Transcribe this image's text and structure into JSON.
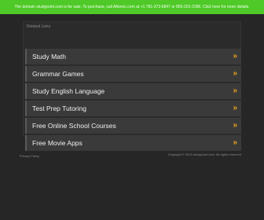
{
  "banner": {
    "text": "The domain studypoint.com is for sale. To purchase, call Afternic.com at +1 781-373-6847 or 855-201-2286. Click here for more details."
  },
  "panel": {
    "title": "Related Links",
    "links": [
      {
        "label": "Study Math",
        "arrow": "»"
      },
      {
        "label": "Grammar Games",
        "arrow": "»"
      },
      {
        "label": "Study English Language",
        "arrow": "»"
      },
      {
        "label": "Test Prep Tutoring",
        "arrow": "»"
      },
      {
        "label": "Free Online School Courses",
        "arrow": "»"
      },
      {
        "label": "Free Movie Apps",
        "arrow": "»"
      }
    ]
  },
  "footer": {
    "privacy": "Privacy Policy",
    "copyright": "Copyright © 2015 studypoint.com. All rights reserved."
  },
  "colors": {
    "banner": "#4fc927",
    "accent_arrow": "#e8a21c",
    "background": "#262626"
  }
}
